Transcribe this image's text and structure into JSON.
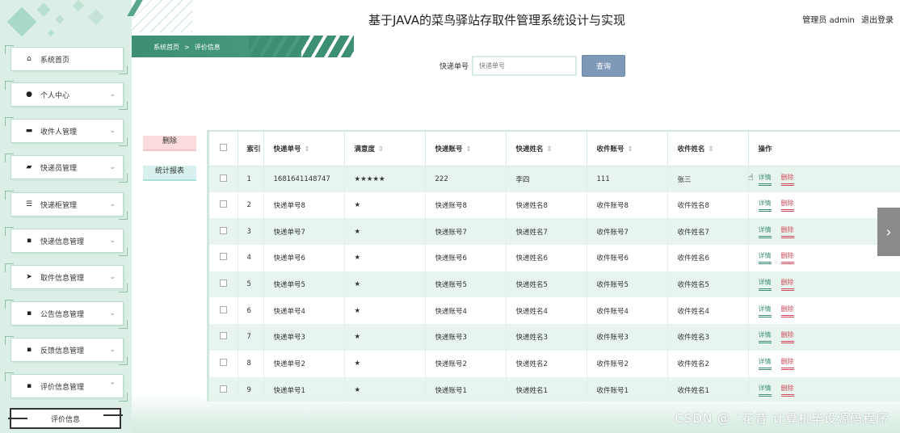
{
  "header": {
    "title": "基于JAVA的菜鸟驿站存取件管理系统设计与实现",
    "user_label": "管理员 admin",
    "logout": "退出登录"
  },
  "breadcrumb": {
    "home": "系统首页",
    "sep": ">",
    "current": "评价信息"
  },
  "sidebar": {
    "items": [
      {
        "label": "系统首页",
        "icon": "home-icon",
        "glyph": "⌂",
        "chevron": ""
      },
      {
        "label": "个人中心",
        "icon": "user-icon",
        "glyph": "●",
        "chevron": "⌄"
      },
      {
        "label": "收件人管理",
        "icon": "monitor-icon",
        "glyph": "▬",
        "chevron": "⌄"
      },
      {
        "label": "快递员管理",
        "icon": "chat-icon",
        "glyph": "▰",
        "chevron": "⌄"
      },
      {
        "label": "快递柜管理",
        "icon": "list-icon",
        "glyph": "☰",
        "chevron": "⌄"
      },
      {
        "label": "快递信息管理",
        "icon": "grid-icon",
        "glyph": "▪",
        "chevron": "⌄"
      },
      {
        "label": "取件信息管理",
        "icon": "send-icon",
        "glyph": "➤",
        "chevron": "⌄"
      },
      {
        "label": "公告信息管理",
        "icon": "grid-icon",
        "glyph": "▪",
        "chevron": "⌄"
      },
      {
        "label": "反馈信息管理",
        "icon": "grid-icon",
        "glyph": "▪",
        "chevron": "⌄"
      },
      {
        "label": "评价信息管理",
        "icon": "grid-icon",
        "glyph": "▪",
        "chevron": "⌃"
      }
    ],
    "sub_item": "评价信息"
  },
  "search": {
    "label": "快递单号",
    "placeholder": "快递单号",
    "button": "查询"
  },
  "actions": {
    "delete": "删除",
    "stats": "统计报表"
  },
  "table": {
    "headers": [
      "索引",
      "快递单号",
      "满意度",
      "快递账号",
      "快递姓名",
      "收件账号",
      "收件姓名",
      "操作"
    ],
    "detail_label": "详情",
    "delete_label": "删除",
    "rows": [
      {
        "idx": "1",
        "no": "1681641148747",
        "rating": "★★★★★",
        "acct": "222",
        "name": "李四",
        "recv_acct": "111",
        "recv_name": "张三"
      },
      {
        "idx": "2",
        "no": "快递单号8",
        "rating": "★",
        "acct": "快递账号8",
        "name": "快递姓名8",
        "recv_acct": "收件账号8",
        "recv_name": "收件姓名8"
      },
      {
        "idx": "3",
        "no": "快递单号7",
        "rating": "★",
        "acct": "快递账号7",
        "name": "快递姓名7",
        "recv_acct": "收件账号7",
        "recv_name": "收件姓名7"
      },
      {
        "idx": "4",
        "no": "快递单号6",
        "rating": "★",
        "acct": "快递账号6",
        "name": "快递姓名6",
        "recv_acct": "收件账号6",
        "recv_name": "收件姓名6"
      },
      {
        "idx": "5",
        "no": "快递单号5",
        "rating": "★",
        "acct": "快递账号5",
        "name": "快递姓名5",
        "recv_acct": "收件账号5",
        "recv_name": "收件姓名5"
      },
      {
        "idx": "6",
        "no": "快递单号4",
        "rating": "★",
        "acct": "快递账号4",
        "name": "快递姓名4",
        "recv_acct": "收件账号4",
        "recv_name": "收件姓名4"
      },
      {
        "idx": "7",
        "no": "快递单号3",
        "rating": "★",
        "acct": "快递账号3",
        "name": "快递姓名3",
        "recv_acct": "收件账号3",
        "recv_name": "收件姓名3"
      },
      {
        "idx": "8",
        "no": "快递单号2",
        "rating": "★",
        "acct": "快递账号2",
        "name": "快递姓名2",
        "recv_acct": "收件账号2",
        "recv_name": "收件姓名2"
      },
      {
        "idx": "9",
        "no": "快递单号1",
        "rating": "★",
        "acct": "快递账号1",
        "name": "快递姓名1",
        "recv_acct": "收件账号1",
        "recv_name": "收件姓名1"
      }
    ]
  },
  "pager": {
    "next_glyph": "›"
  },
  "watermark": "CSDN @ `花昔 计算机毕设源码程序",
  "colors": {
    "accent": "#3d8f74",
    "sidebar_bg": "#dcefe6",
    "row_alt": "#e8f5ef",
    "danger": "#d24a5a",
    "search_btn": "#7e98b8"
  }
}
